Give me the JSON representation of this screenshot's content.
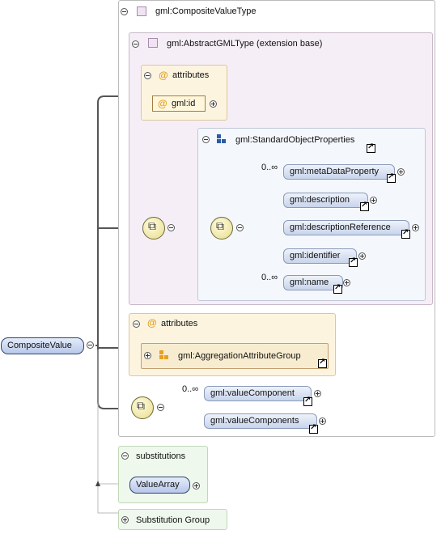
{
  "root_element": "CompositeValue",
  "composite_type": "gml:CompositeValueType",
  "abstract_type": "gml:AbstractGMLType (extension base)",
  "attributes_label": "attributes",
  "attr_id": "gml:id",
  "standard_props": "gml:StandardObjectProperties",
  "props": [
    {
      "card": "0..∞",
      "label": "gml:metaDataProperty"
    },
    {
      "card": "",
      "label": "gml:description"
    },
    {
      "card": "",
      "label": "gml:descriptionReference"
    },
    {
      "card": "",
      "label": "gml:identifier"
    },
    {
      "card": "0..∞",
      "label": "gml:name"
    }
  ],
  "attributes2_label": "attributes",
  "aggregation_group": "gml:AggregationAttributeGroup",
  "value_card": "0..∞",
  "value_component": "gml:valueComponent",
  "value_components": "gml:valueComponents",
  "substitutions_label": "substitutions",
  "substitution_item": "ValueArray",
  "substitution_group": "Substitution Group"
}
